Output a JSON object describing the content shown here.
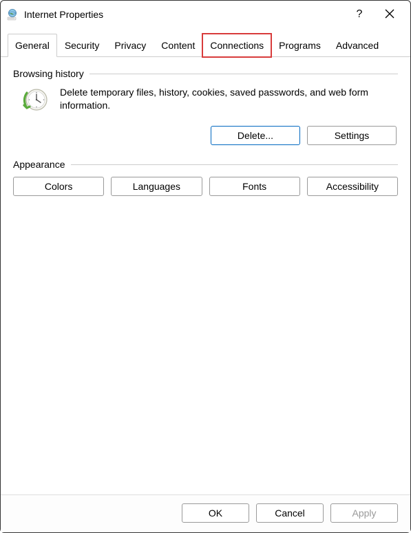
{
  "window": {
    "title": "Internet Properties"
  },
  "tabs": {
    "general": "General",
    "security": "Security",
    "privacy": "Privacy",
    "content": "Content",
    "connections": "Connections",
    "programs": "Programs",
    "advanced": "Advanced"
  },
  "sections": {
    "browsing_history": {
      "label": "Browsing history",
      "description": "Delete temporary files, history, cookies, saved passwords, and web form information.",
      "delete_btn": "Delete...",
      "settings_btn": "Settings"
    },
    "appearance": {
      "label": "Appearance",
      "colors_btn": "Colors",
      "languages_btn": "Languages",
      "fonts_btn": "Fonts",
      "accessibility_btn": "Accessibility"
    }
  },
  "footer": {
    "ok": "OK",
    "cancel": "Cancel",
    "apply": "Apply"
  }
}
